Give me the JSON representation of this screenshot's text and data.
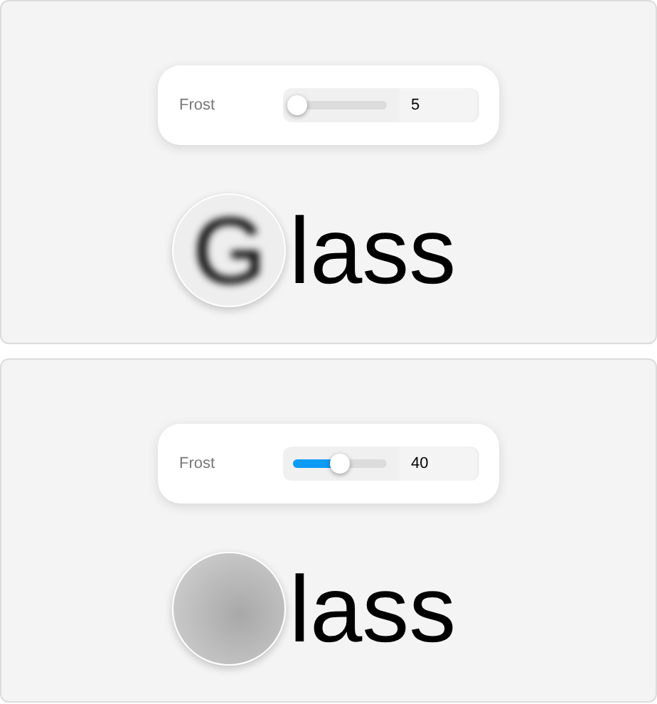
{
  "panels": [
    {
      "control": {
        "label": "Frost",
        "level": 0.04,
        "value": "5"
      },
      "lens_text": "G",
      "text": "lass"
    },
    {
      "control": {
        "label": "Frost",
        "level": 0.5,
        "value": "40"
      },
      "text": "lass"
    }
  ]
}
